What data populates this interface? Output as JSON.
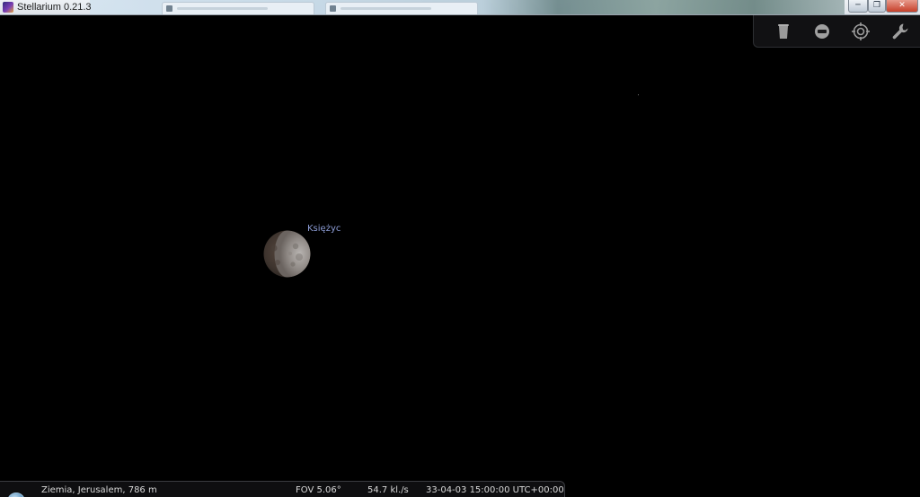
{
  "window": {
    "title": "Stellarium 0.21.3",
    "controls": {
      "minimize_icon": "minimize-icon",
      "maximize_icon": "maximize-icon",
      "close_icon": "close-icon"
    }
  },
  "toolbar": {
    "buttons": [
      {
        "name": "trash-icon"
      },
      {
        "name": "stop-icon"
      },
      {
        "name": "target-icon"
      },
      {
        "name": "wrench-icon"
      }
    ]
  },
  "sky": {
    "object_label": "Księżyc"
  },
  "status": {
    "location": "Ziemia, Jerusalem, 786 m",
    "fov": "FOV 5.06°",
    "fps": "54.7 kl./s",
    "datetime": "33-04-03 15:00:00 UTC+00:00"
  },
  "colors": {
    "sky_background": "#000000",
    "label_color": "#8e9ed8",
    "status_text": "#d8d8d8"
  }
}
